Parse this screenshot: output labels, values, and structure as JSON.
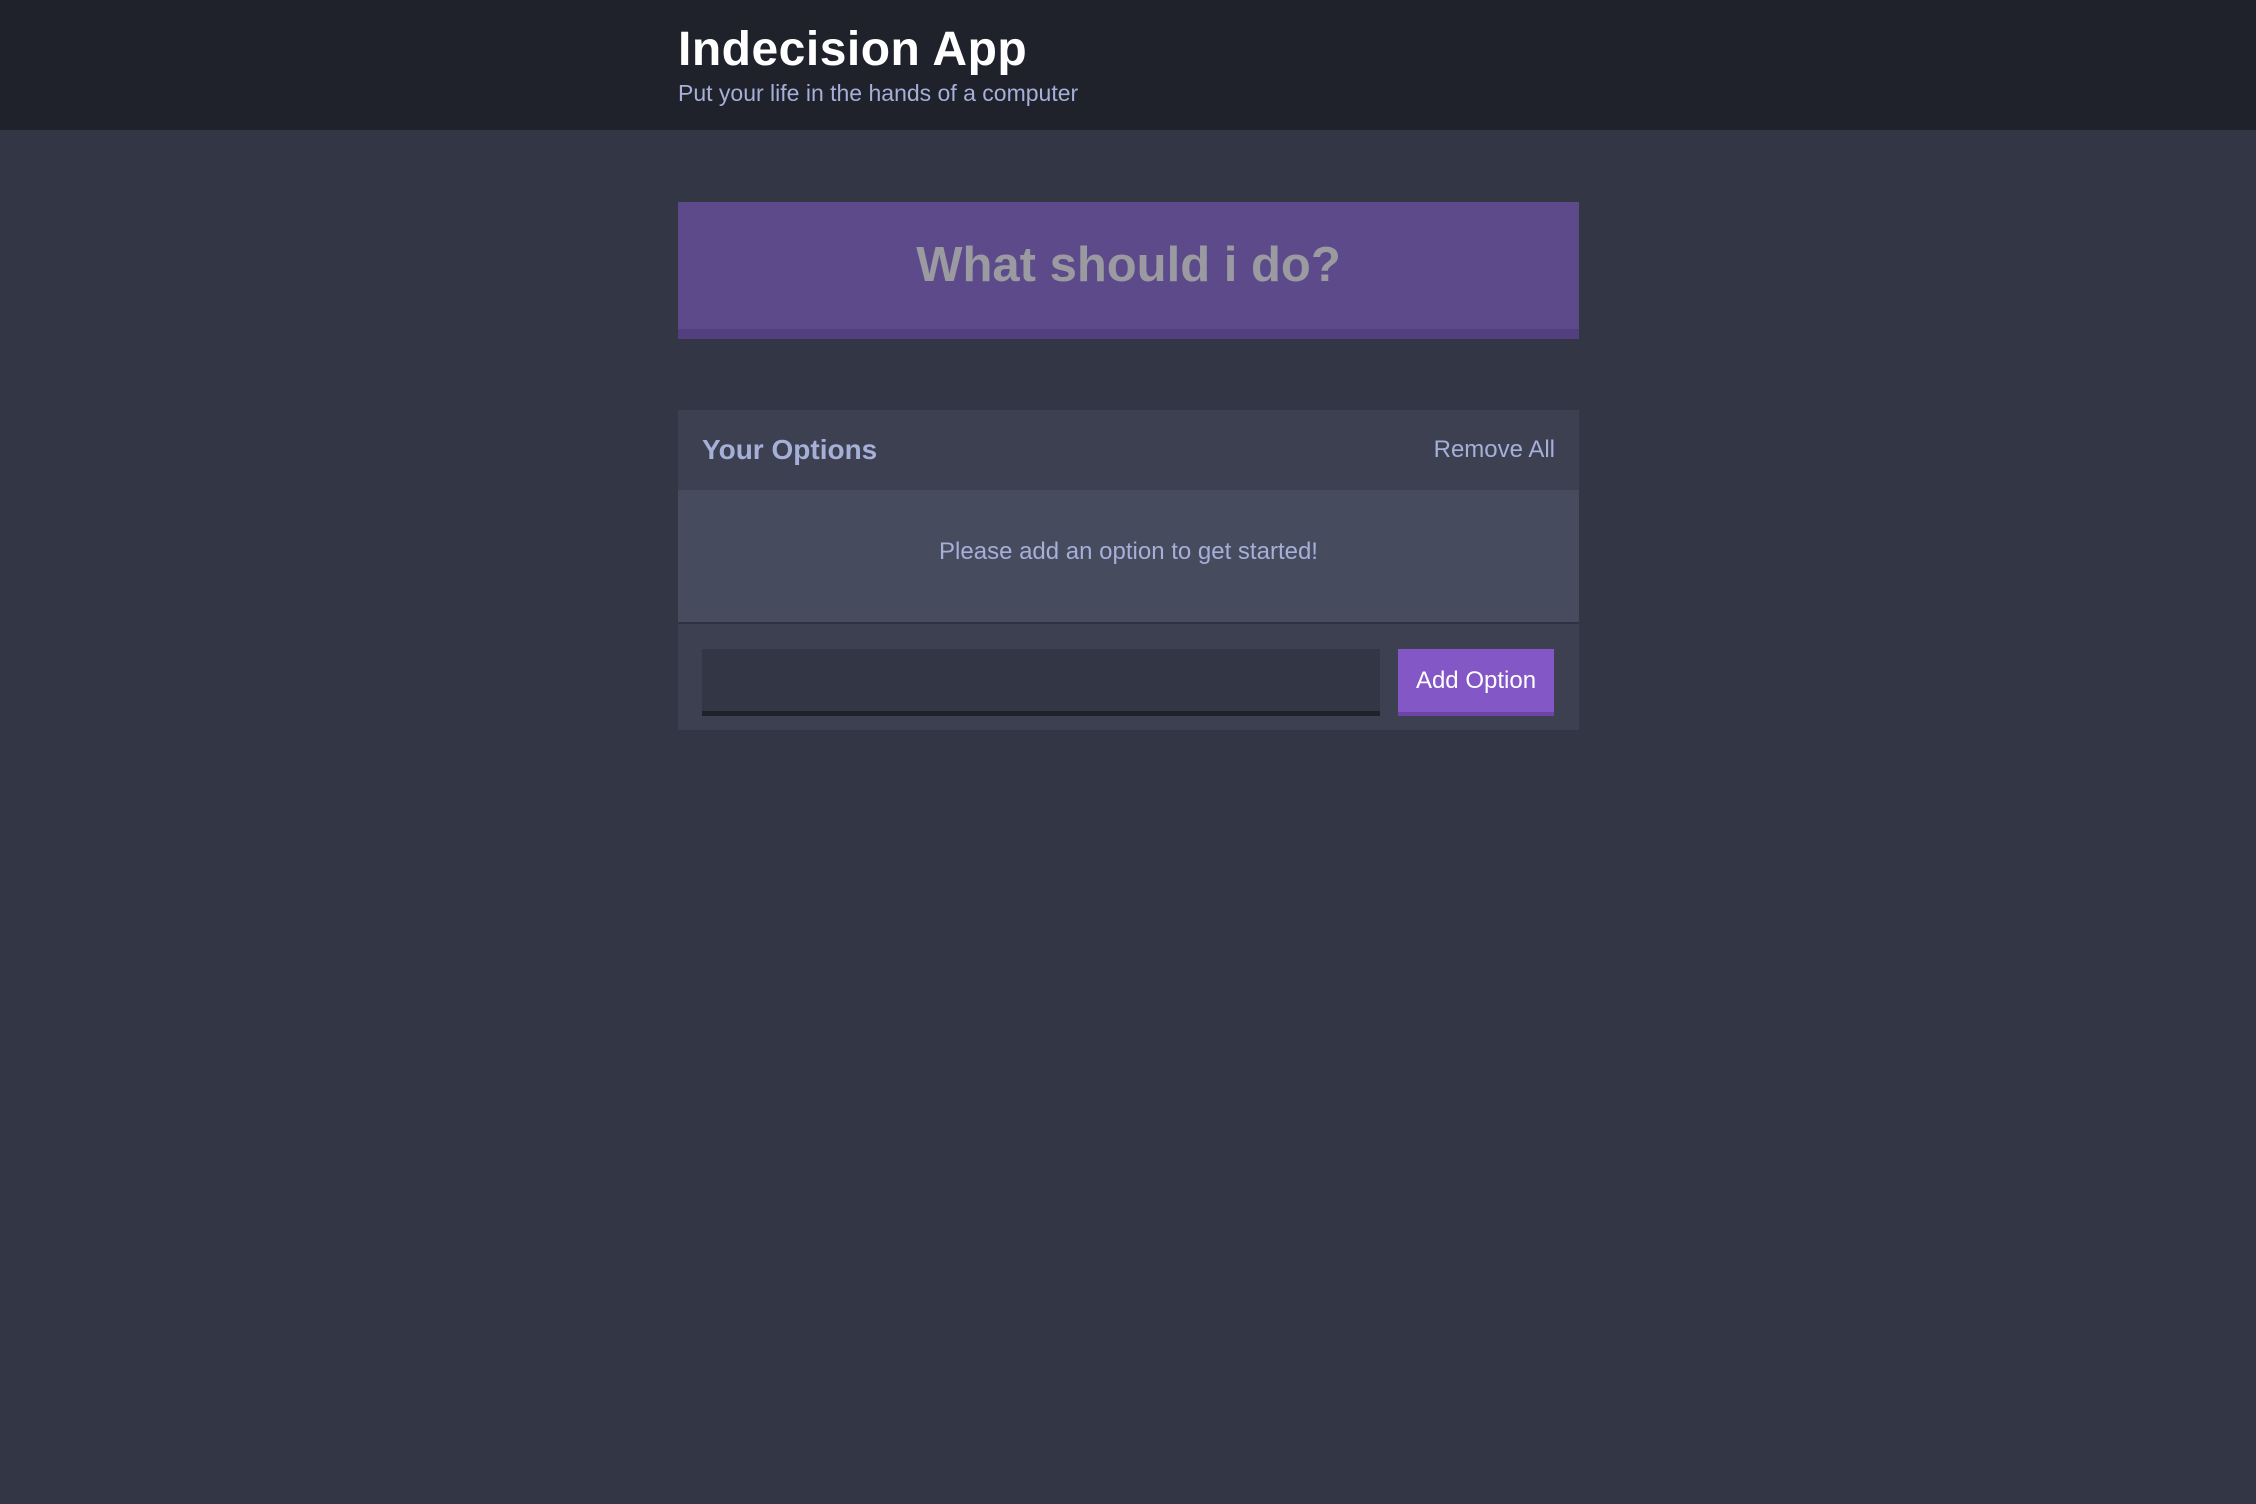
{
  "header": {
    "title": "Indecision App",
    "subtitle": "Put your life in the hands of a computer"
  },
  "action": {
    "label": "What should i do?"
  },
  "options": {
    "title": "Your Options",
    "remove_all_label": "Remove All",
    "empty_message": "Please add an option to get started!",
    "input_value": "",
    "input_placeholder": "",
    "add_button_label": "Add Option"
  },
  "colors": {
    "header_bg": "#20222b",
    "page_bg": "#333645",
    "action_bg": "#5c4a8a",
    "accent": "#8357c5",
    "muted_text": "#a5afd7"
  }
}
